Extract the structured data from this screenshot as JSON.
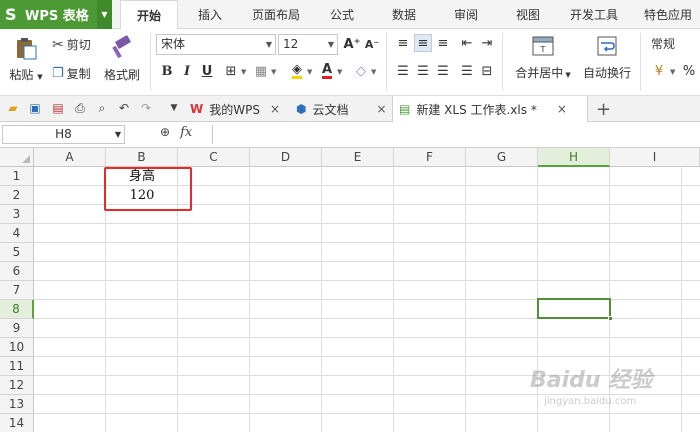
{
  "app": {
    "name": "WPS 表格",
    "logo_letter": "S"
  },
  "menu_tabs": [
    "开始",
    "插入",
    "页面布局",
    "公式",
    "数据",
    "审阅",
    "视图",
    "开发工具",
    "特色应用"
  ],
  "active_tab": "开始",
  "ribbon": {
    "paste": "粘贴",
    "cut": "剪切",
    "copy": "复制",
    "format_painter": "格式刷",
    "font_name": "宋体",
    "font_size": "12",
    "merge_center": "合并居中",
    "wrap_text": "自动换行",
    "number_format": "常规",
    "percent": "%",
    "bold": "B",
    "italic": "I",
    "underline": "U",
    "font_color_letter": "A",
    "increase_font": "A⁺",
    "decrease_font": "A⁻"
  },
  "doc_tabs": [
    {
      "label": "我的WPS",
      "close": "×"
    },
    {
      "label": "云文档",
      "close": "×"
    },
    {
      "label": "新建 XLS 工作表.xls *",
      "close": "×"
    }
  ],
  "new_tab_label": "+",
  "formula_bar": {
    "name_box": "H8",
    "fx": "fx",
    "zoom_icon": "🔍",
    "value": ""
  },
  "columns": [
    "A",
    "B",
    "C",
    "D",
    "E",
    "F",
    "G",
    "H",
    "I"
  ],
  "rows": [
    "1",
    "2",
    "3",
    "4",
    "5",
    "6",
    "7",
    "8",
    "9",
    "10",
    "11",
    "12",
    "13",
    "14"
  ],
  "selected_cell": "H8",
  "cells": {
    "B1": "身高",
    "B2": "120"
  },
  "watermark": {
    "line1": "Baidu 经验",
    "line2": "jingyan.baidu.com"
  },
  "colors": {
    "accent_green": "#4c9a35",
    "highlight_red": "#e32b2b"
  }
}
